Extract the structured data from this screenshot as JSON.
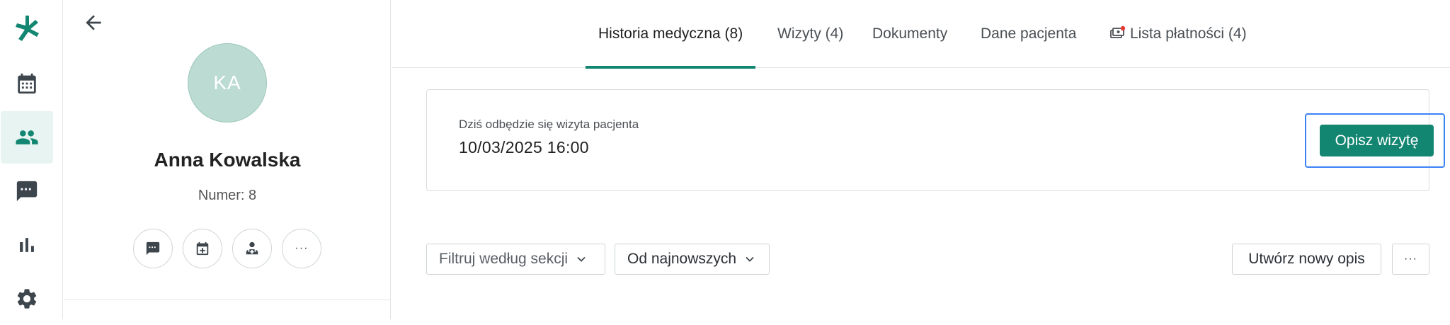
{
  "rail": {
    "items": [
      {
        "name": "logo-icon"
      },
      {
        "name": "calendar-icon"
      },
      {
        "name": "patients-icon",
        "active": true
      },
      {
        "name": "messages-icon"
      },
      {
        "name": "statistics-icon"
      },
      {
        "name": "settings-icon"
      }
    ],
    "accent": "#138672"
  },
  "patient": {
    "initials": "KA",
    "name": "Anna Kowalska",
    "number_label": "Numer: 8",
    "quick_actions": [
      "message-icon",
      "add-event-icon",
      "doctor-icon",
      "more-icon"
    ],
    "more_glyph": "···"
  },
  "tabs": [
    {
      "label": "Historia medyczna (8)",
      "active": true
    },
    {
      "label": "Wizyty (4)"
    },
    {
      "label": "Dokumenty"
    },
    {
      "label": "Dane pacjenta"
    },
    {
      "label": "Lista płatności (4)",
      "icon": "payments-icon"
    }
  ],
  "visit": {
    "subtitle": "Dziś odbędzie się wizyta pacjenta",
    "datetime": "10/03/2025 16:00",
    "button_label": "Opisz wizytę"
  },
  "toolbar": {
    "filter_label": "Filtruj według sekcji",
    "sort_label": "Od najnowszych",
    "new_label": "Utwórz nowy opis",
    "more_label": "···"
  },
  "colors": {
    "primary": "#138672",
    "avatar_bg": "#bcdcd3",
    "focus_ring": "#3b82f6",
    "badge": "#e53935"
  }
}
